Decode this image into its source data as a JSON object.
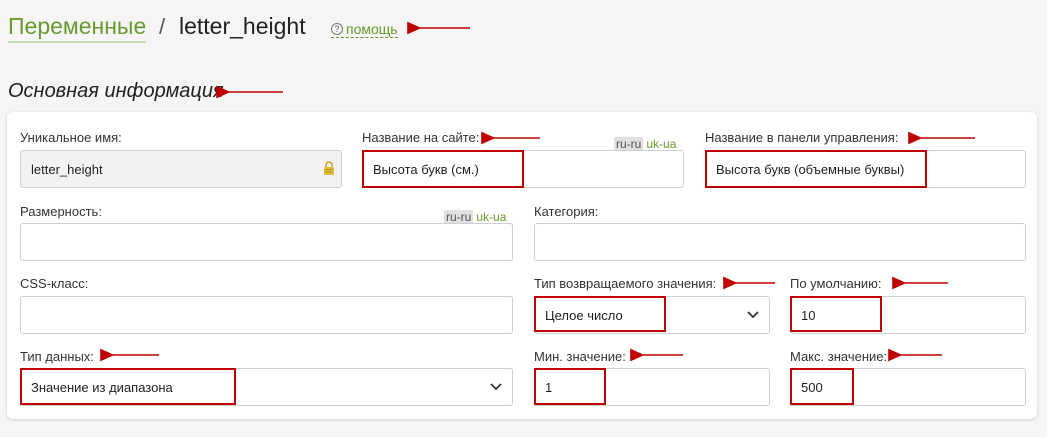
{
  "header": {
    "crumb_link": "Переменные",
    "separator": "/",
    "current": "letter_height",
    "help_label": "помощь"
  },
  "section_title": "Основная информация",
  "colors": {
    "accent": "#6a9a2f",
    "highlight": "#c00000"
  },
  "lang": {
    "active": "ru-ru",
    "other": "uk-ua"
  },
  "fields": {
    "unique_name": {
      "label": "Уникальное имя:",
      "value": "letter_height"
    },
    "site_name": {
      "label": "Название на сайте:",
      "value": "Высота букв (см.)"
    },
    "admin_name": {
      "label": "Название в панели управления:",
      "value": "Высота букв (объемные буквы)"
    },
    "dimension": {
      "label": "Размерность:",
      "value": ""
    },
    "category": {
      "label": "Категория:",
      "value": ""
    },
    "css_class": {
      "label": "CSS-класс:",
      "value": ""
    },
    "return_type": {
      "label": "Тип возвращаемого значения:",
      "value": "Целое число"
    },
    "default": {
      "label": "По умолчанию:",
      "value": "10"
    },
    "data_type": {
      "label": "Тип данных:",
      "value": "Значение из диапазона"
    },
    "min": {
      "label": "Мин. значение:",
      "value": "1"
    },
    "max": {
      "label": "Макс. значение:",
      "value": "500"
    }
  }
}
